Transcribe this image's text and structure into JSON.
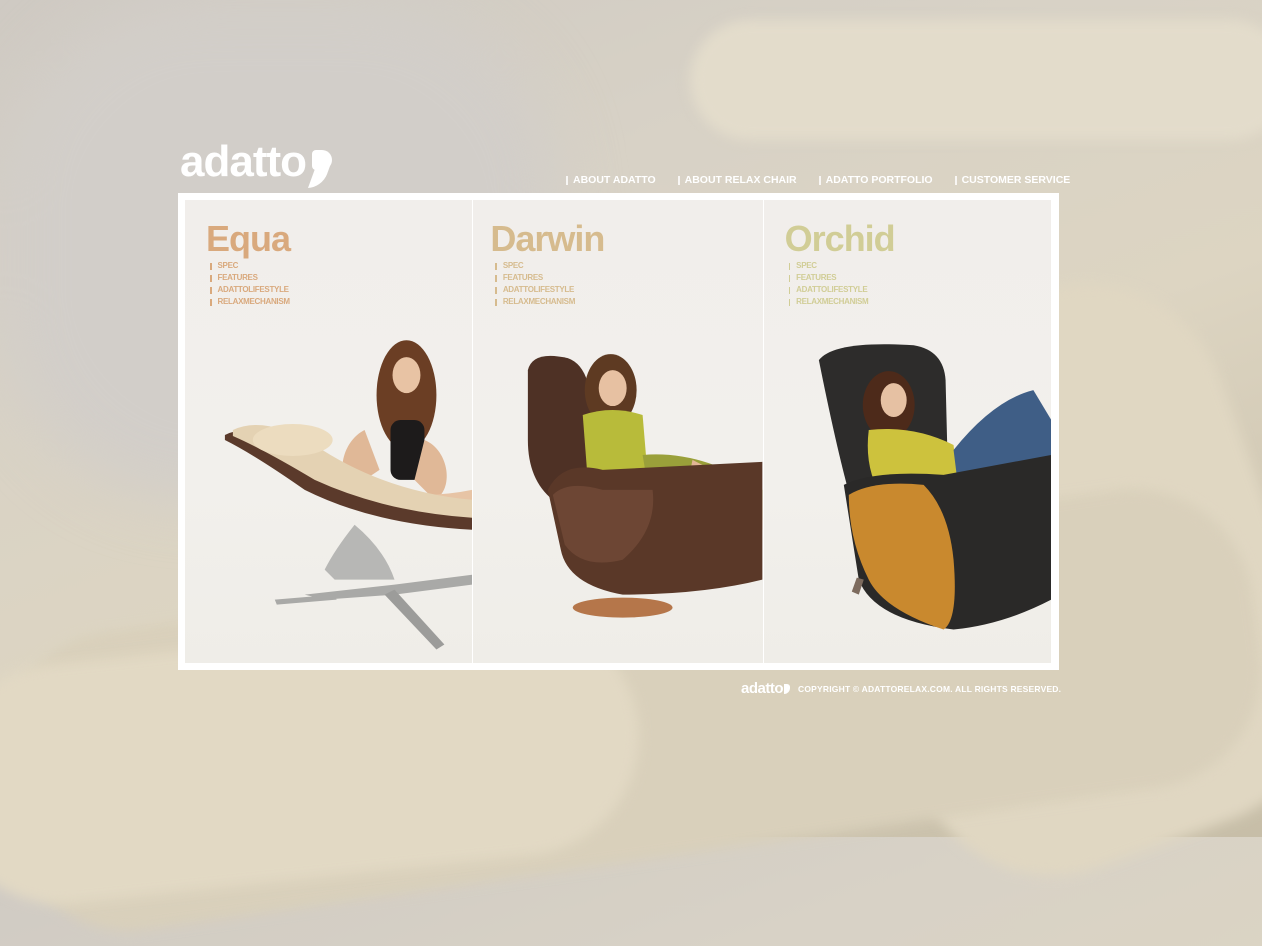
{
  "logo": {
    "text": "adatto"
  },
  "nav": [
    {
      "label": "ABOUT ADATTO"
    },
    {
      "label": "ABOUT RELAX CHAIR"
    },
    {
      "label": "ADATTO PORTFOLIO"
    },
    {
      "label": "CUSTOMER SERVICE"
    }
  ],
  "products": [
    {
      "name": "Equa",
      "color": "#d9a97d",
      "links": [
        "SPEC",
        "FEATURES",
        "ADATTOLIFESTYLE",
        "RELAXMECHANISM"
      ]
    },
    {
      "name": "Darwin",
      "color": "#d6bb8e",
      "links": [
        "SPEC",
        "FEATURES",
        "ADATTOLIFESTYLE",
        "RELAXMECHANISM"
      ]
    },
    {
      "name": "Orchid",
      "color": "#d1cd96",
      "links": [
        "SPEC",
        "FEATURES",
        "ADATTOLIFESTYLE",
        "RELAXMECHANISM"
      ]
    }
  ],
  "footer": {
    "logo": "adatto",
    "copyright": "COPYRIGHT ©  ADATTORELAX.COM.  ALL RIGHTS RESERVED."
  }
}
